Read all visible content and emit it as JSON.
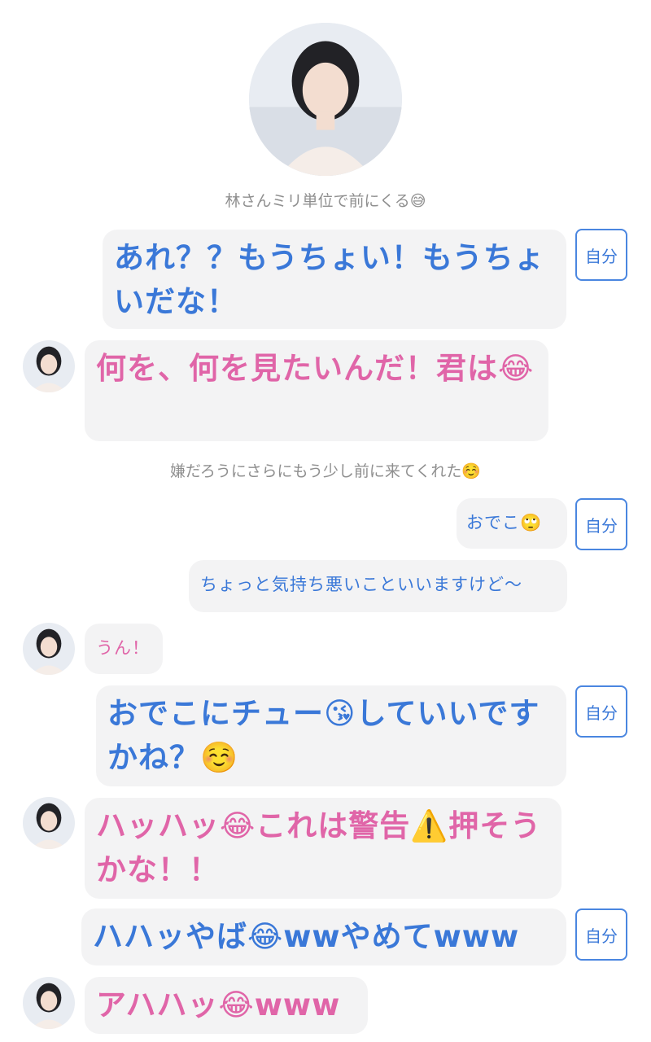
{
  "header": {
    "avatar_icon": "profile-photo"
  },
  "messages": [
    {
      "type": "narration",
      "text": "林さんミリ単位で前にくる😅"
    },
    {
      "type": "me",
      "text": "あれ？？もうちょい！もうちょいだな！",
      "tag": "自分"
    },
    {
      "type": "her",
      "text": "何を、何を見たいんだ！君は😂"
    },
    {
      "type": "narration",
      "text": "嫌だろうにさらにもう少し前に来てくれた☺️"
    },
    {
      "type": "me",
      "text": "おでこ🙄",
      "tag": "自分"
    },
    {
      "type": "me",
      "text": "ちょっと気持ち悪いこといいますけど〜"
    },
    {
      "type": "her",
      "text": "うん！"
    },
    {
      "type": "me",
      "text": "おでこにチュー😘していいですかね？☺️",
      "tag": "自分"
    },
    {
      "type": "her",
      "text": "ハッハッ😂これは警告⚠️押そうかな！！"
    },
    {
      "type": "me",
      "text": "ハハッやば😂wwやめてwww",
      "tag": "自分"
    },
    {
      "type": "her",
      "text": "アハハッ😂www"
    }
  ],
  "colors": {
    "me": "#3a78d8",
    "her": "#e065a8",
    "narration": "#8f8f8f",
    "bubble": "#f3f3f4"
  }
}
